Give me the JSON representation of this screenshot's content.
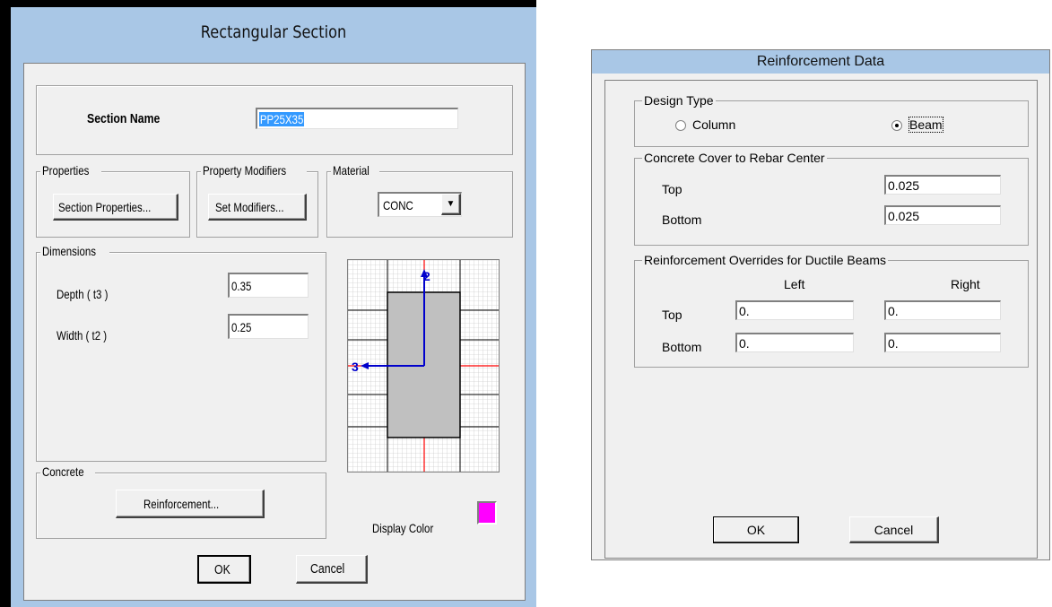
{
  "section_dialog": {
    "title": "Rectangular Section",
    "section_name_label": "Section Name",
    "section_name_value": "PP25X35",
    "properties": {
      "group_label": "Properties",
      "button": "Section Properties..."
    },
    "modifiers": {
      "group_label": "Property Modifiers",
      "button": "Set Modifiers..."
    },
    "material": {
      "group_label": "Material",
      "selected": "CONC"
    },
    "dimensions": {
      "group_label": "Dimensions",
      "depth_label": "Depth  ( t3 )",
      "depth_value": "0.35",
      "width_label": "Width  ( t2 )",
      "width_value": "0.25"
    },
    "preview": {
      "axis_2": "2",
      "axis_3": "3"
    },
    "concrete": {
      "group_label": "Concrete",
      "button": "Reinforcement..."
    },
    "display_color_label": "Display Color",
    "display_color": "#ff00ff",
    "ok": "OK",
    "cancel": "Cancel"
  },
  "reinf_dialog": {
    "title": "Reinforcement Data",
    "design_type": {
      "group_label": "Design Type",
      "column": "Column",
      "beam": "Beam",
      "selected": "Beam"
    },
    "cover": {
      "group_label": "Concrete Cover to Rebar Center",
      "top_label": "Top",
      "top_value": "0.025",
      "bottom_label": "Bottom",
      "bottom_value": "0.025"
    },
    "overrides": {
      "group_label": "Reinforcement Overrides for Ductile Beams",
      "left_header": "Left",
      "right_header": "Right",
      "top_label": "Top",
      "bottom_label": "Bottom",
      "top_left": "0.",
      "top_right": "0.",
      "bottom_left": "0.",
      "bottom_right": "0."
    },
    "ok": "OK",
    "cancel": "Cancel"
  },
  "colors": {
    "titlebar": "#a9c7e6",
    "dialog_bg": "#f0f0f0",
    "selection": "#3399ff",
    "axis_blue": "#0000cc",
    "axis_red": "#ff0000"
  }
}
